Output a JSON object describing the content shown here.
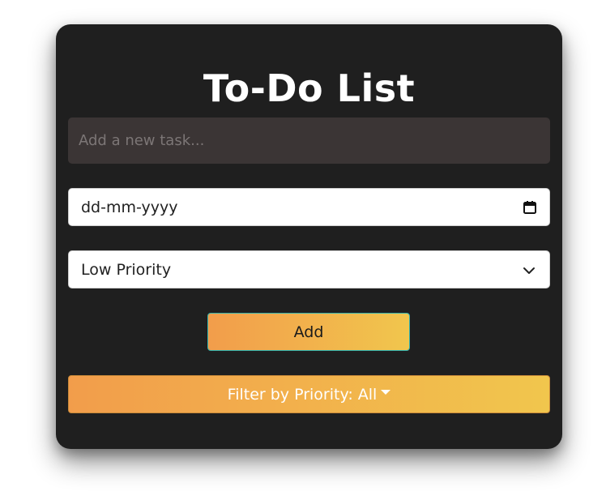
{
  "app": {
    "title": "To-Do List"
  },
  "form": {
    "task_input": {
      "value": "",
      "placeholder": "Add a new task..."
    },
    "date_input": {
      "placeholder": "dd-mm-yyyy",
      "icon": "calendar-icon"
    },
    "priority_select": {
      "selected": "Low Priority",
      "icon": "chevron-down-icon"
    },
    "add_button": {
      "label": "Add"
    }
  },
  "filter": {
    "label": "Filter by Priority: All",
    "icon": "caret-down-icon"
  },
  "colors": {
    "card_background": "#1f1f1f",
    "input_background": "#3b3535",
    "gradient_start": "#f29d4b",
    "gradient_end": "#f1c64d",
    "add_button_border": "#35b4ae"
  }
}
